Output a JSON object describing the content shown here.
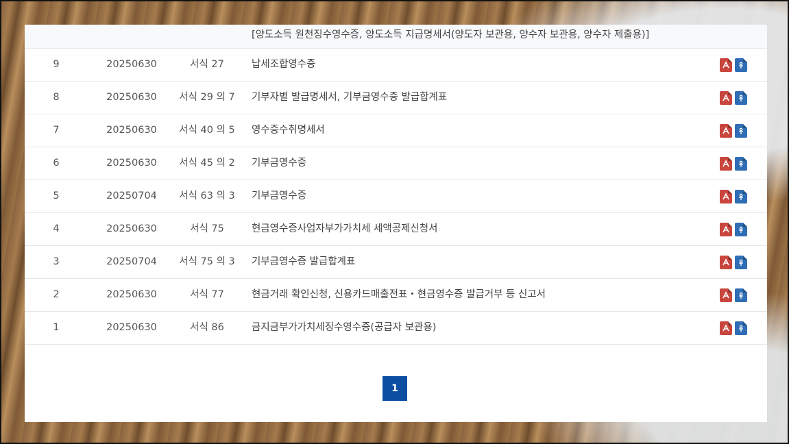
{
  "table": {
    "partial_row": {
      "name": "[양도소득 원천징수영수증, 양도소득 지급명세서(양도자 보관용, 양수자 보관용, 양수자 제출용)]"
    },
    "rows": [
      {
        "no": "9",
        "date": "20250630",
        "form": "서식 27",
        "name": "납세조합영수증"
      },
      {
        "no": "8",
        "date": "20250630",
        "form": "서식 29 의 7",
        "name": "기부자별 발급명세서, 기부금영수증 발급합계표"
      },
      {
        "no": "7",
        "date": "20250630",
        "form": "서식 40 의 5",
        "name": "영수증수취명세서"
      },
      {
        "no": "6",
        "date": "20250630",
        "form": "서식 45 의 2",
        "name": "기부금영수증"
      },
      {
        "no": "5",
        "date": "20250704",
        "form": "서식 63 의 3",
        "name": "기부금영수증"
      },
      {
        "no": "4",
        "date": "20250630",
        "form": "서식 75",
        "name": "현금영수증사업자부가가치세 세액공제신청서"
      },
      {
        "no": "3",
        "date": "20250704",
        "form": "서식 75 의 3",
        "name": "기부금영수증 발급합계표"
      },
      {
        "no": "2",
        "date": "20250630",
        "form": "서식 77",
        "name": "현금거래 확인신청, 신용카드매출전표・현금영수증 발급거부 등 신고서"
      },
      {
        "no": "1",
        "date": "20250630",
        "form": "서식 86",
        "name": "금지금부가가치세징수영수증(공급자 보관용)"
      }
    ],
    "icons": [
      "pdf-file-icon",
      "hwp-file-icon"
    ]
  },
  "pagination": {
    "current": "1"
  },
  "colors": {
    "pdf": "#c9463f",
    "hwp": "#2f6db5",
    "pager": "#0b4ea2"
  }
}
